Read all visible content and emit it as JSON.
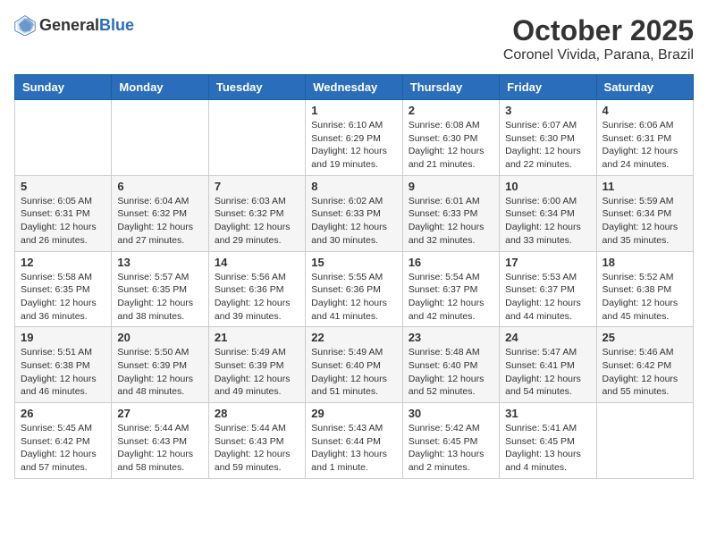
{
  "header": {
    "logo_general": "General",
    "logo_blue": "Blue",
    "month_title": "October 2025",
    "location": "Coronel Vivida, Parana, Brazil"
  },
  "weekdays": [
    "Sunday",
    "Monday",
    "Tuesday",
    "Wednesday",
    "Thursday",
    "Friday",
    "Saturday"
  ],
  "weeks": [
    [
      {
        "day": "",
        "info": ""
      },
      {
        "day": "",
        "info": ""
      },
      {
        "day": "",
        "info": ""
      },
      {
        "day": "1",
        "info": "Sunrise: 6:10 AM\nSunset: 6:29 PM\nDaylight: 12 hours\nand 19 minutes."
      },
      {
        "day": "2",
        "info": "Sunrise: 6:08 AM\nSunset: 6:30 PM\nDaylight: 12 hours\nand 21 minutes."
      },
      {
        "day": "3",
        "info": "Sunrise: 6:07 AM\nSunset: 6:30 PM\nDaylight: 12 hours\nand 22 minutes."
      },
      {
        "day": "4",
        "info": "Sunrise: 6:06 AM\nSunset: 6:31 PM\nDaylight: 12 hours\nand 24 minutes."
      }
    ],
    [
      {
        "day": "5",
        "info": "Sunrise: 6:05 AM\nSunset: 6:31 PM\nDaylight: 12 hours\nand 26 minutes."
      },
      {
        "day": "6",
        "info": "Sunrise: 6:04 AM\nSunset: 6:32 PM\nDaylight: 12 hours\nand 27 minutes."
      },
      {
        "day": "7",
        "info": "Sunrise: 6:03 AM\nSunset: 6:32 PM\nDaylight: 12 hours\nand 29 minutes."
      },
      {
        "day": "8",
        "info": "Sunrise: 6:02 AM\nSunset: 6:33 PM\nDaylight: 12 hours\nand 30 minutes."
      },
      {
        "day": "9",
        "info": "Sunrise: 6:01 AM\nSunset: 6:33 PM\nDaylight: 12 hours\nand 32 minutes."
      },
      {
        "day": "10",
        "info": "Sunrise: 6:00 AM\nSunset: 6:34 PM\nDaylight: 12 hours\nand 33 minutes."
      },
      {
        "day": "11",
        "info": "Sunrise: 5:59 AM\nSunset: 6:34 PM\nDaylight: 12 hours\nand 35 minutes."
      }
    ],
    [
      {
        "day": "12",
        "info": "Sunrise: 5:58 AM\nSunset: 6:35 PM\nDaylight: 12 hours\nand 36 minutes."
      },
      {
        "day": "13",
        "info": "Sunrise: 5:57 AM\nSunset: 6:35 PM\nDaylight: 12 hours\nand 38 minutes."
      },
      {
        "day": "14",
        "info": "Sunrise: 5:56 AM\nSunset: 6:36 PM\nDaylight: 12 hours\nand 39 minutes."
      },
      {
        "day": "15",
        "info": "Sunrise: 5:55 AM\nSunset: 6:36 PM\nDaylight: 12 hours\nand 41 minutes."
      },
      {
        "day": "16",
        "info": "Sunrise: 5:54 AM\nSunset: 6:37 PM\nDaylight: 12 hours\nand 42 minutes."
      },
      {
        "day": "17",
        "info": "Sunrise: 5:53 AM\nSunset: 6:37 PM\nDaylight: 12 hours\nand 44 minutes."
      },
      {
        "day": "18",
        "info": "Sunrise: 5:52 AM\nSunset: 6:38 PM\nDaylight: 12 hours\nand 45 minutes."
      }
    ],
    [
      {
        "day": "19",
        "info": "Sunrise: 5:51 AM\nSunset: 6:38 PM\nDaylight: 12 hours\nand 46 minutes."
      },
      {
        "day": "20",
        "info": "Sunrise: 5:50 AM\nSunset: 6:39 PM\nDaylight: 12 hours\nand 48 minutes."
      },
      {
        "day": "21",
        "info": "Sunrise: 5:49 AM\nSunset: 6:39 PM\nDaylight: 12 hours\nand 49 minutes."
      },
      {
        "day": "22",
        "info": "Sunrise: 5:49 AM\nSunset: 6:40 PM\nDaylight: 12 hours\nand 51 minutes."
      },
      {
        "day": "23",
        "info": "Sunrise: 5:48 AM\nSunset: 6:40 PM\nDaylight: 12 hours\nand 52 minutes."
      },
      {
        "day": "24",
        "info": "Sunrise: 5:47 AM\nSunset: 6:41 PM\nDaylight: 12 hours\nand 54 minutes."
      },
      {
        "day": "25",
        "info": "Sunrise: 5:46 AM\nSunset: 6:42 PM\nDaylight: 12 hours\nand 55 minutes."
      }
    ],
    [
      {
        "day": "26",
        "info": "Sunrise: 5:45 AM\nSunset: 6:42 PM\nDaylight: 12 hours\nand 57 minutes."
      },
      {
        "day": "27",
        "info": "Sunrise: 5:44 AM\nSunset: 6:43 PM\nDaylight: 12 hours\nand 58 minutes."
      },
      {
        "day": "28",
        "info": "Sunrise: 5:44 AM\nSunset: 6:43 PM\nDaylight: 12 hours\nand 59 minutes."
      },
      {
        "day": "29",
        "info": "Sunrise: 5:43 AM\nSunset: 6:44 PM\nDaylight: 13 hours\nand 1 minute."
      },
      {
        "day": "30",
        "info": "Sunrise: 5:42 AM\nSunset: 6:45 PM\nDaylight: 13 hours\nand 2 minutes."
      },
      {
        "day": "31",
        "info": "Sunrise: 5:41 AM\nSunset: 6:45 PM\nDaylight: 13 hours\nand 4 minutes."
      },
      {
        "day": "",
        "info": ""
      }
    ]
  ]
}
